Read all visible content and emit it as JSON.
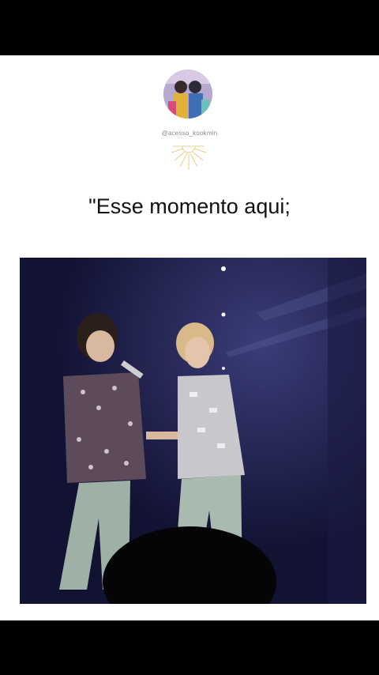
{
  "profile": {
    "handle": "@acesso_kookmin"
  },
  "post": {
    "caption": "\"Esse momento aqui;"
  },
  "colors": {
    "background": "#000000",
    "card": "#ffffff",
    "stage": "#141538",
    "sun_icon": "#e6cf8a"
  }
}
